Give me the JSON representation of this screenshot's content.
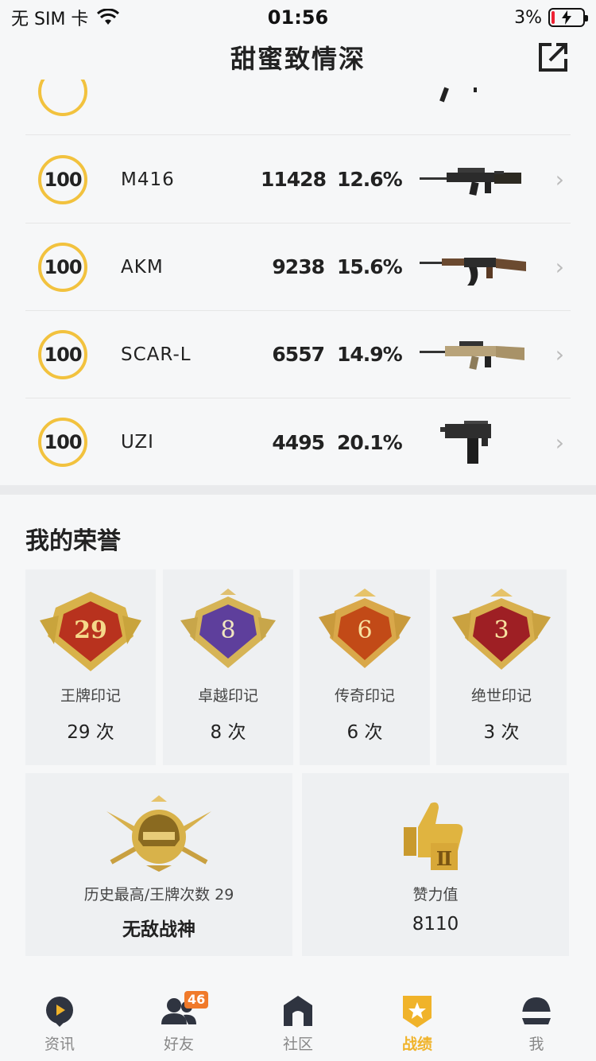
{
  "status_bar": {
    "carrier": "无 SIM 卡",
    "time": "01:56",
    "battery": "3%"
  },
  "nav": {
    "title": "甜蜜致情深",
    "share_icon": "share-external-icon"
  },
  "weapons": [
    {
      "level": "100",
      "name": "M416",
      "kills": "11428",
      "rate": "12.6%",
      "gun": "m416"
    },
    {
      "level": "100",
      "name": "AKM",
      "kills": "9238",
      "rate": "15.6%",
      "gun": "akm"
    },
    {
      "level": "100",
      "name": "SCAR-L",
      "kills": "6557",
      "rate": "14.9%",
      "gun": "scar"
    },
    {
      "level": "100",
      "name": "UZI",
      "kills": "4495",
      "rate": "20.1%",
      "gun": "uzi"
    }
  ],
  "honor": {
    "title": "我的荣誉",
    "badges": [
      {
        "number": "29",
        "label": "王牌印记",
        "count": "29 次",
        "color": "#b8321e"
      },
      {
        "number": "8",
        "label": "卓越印记",
        "count": "8 次",
        "color": "#5e3f9c"
      },
      {
        "number": "6",
        "label": "传奇印记",
        "count": "6 次",
        "color": "#c24a17"
      },
      {
        "number": "3",
        "label": "绝世印记",
        "count": "3 次",
        "color": "#9e1f24"
      }
    ],
    "highest": {
      "label": "历史最高/王牌次数 29",
      "value": "无敌战神"
    },
    "likes": {
      "label": "赞力值",
      "value": "8110"
    }
  },
  "tabs": [
    {
      "label": "资讯",
      "icon": "news-play-icon",
      "active": false
    },
    {
      "label": "好友",
      "icon": "friends-icon",
      "active": false,
      "badge": "46"
    },
    {
      "label": "社区",
      "icon": "community-house-icon",
      "active": false
    },
    {
      "label": "战绩",
      "icon": "record-shield-icon",
      "active": true
    },
    {
      "label": "我",
      "icon": "helmet-icon",
      "active": false
    }
  ],
  "colors": {
    "accent": "#f0b32a",
    "ring": "#f2c23e"
  }
}
